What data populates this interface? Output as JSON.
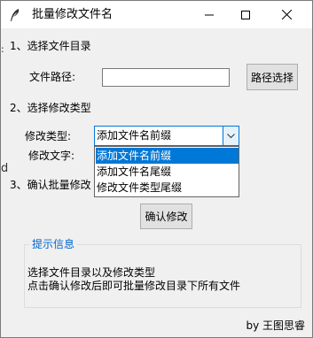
{
  "window": {
    "title": "批量修改文件名",
    "feather_icon": "feather-icon",
    "minimize_icon": "minimize-icon",
    "maximize_icon": "maximize-icon",
    "close_icon": "close-icon"
  },
  "edge_artifacts": {
    "left_colon": ":",
    "left_d": "d"
  },
  "section1": {
    "heading": "1、选择文件目录",
    "path_label": "文件路径:",
    "path_value": "",
    "browse_button": "路径选择"
  },
  "section2": {
    "heading": "2、选择修改类型",
    "type_label": "修改类型:",
    "type_selected": "添加文件名前缀",
    "text_label": "修改文字:",
    "options": [
      "添加文件名前缀",
      "添加文件名尾缀",
      "修改文件类型尾缀"
    ],
    "selected_index": 0
  },
  "section3": {
    "heading": "3、确认批量修改",
    "confirm_button": "确认修改"
  },
  "info": {
    "title": "提示信息",
    "line1": "选择文件目录以及修改类型",
    "line2": "点击确认修改后即可批量修改目录下所有文件"
  },
  "footer": {
    "author": "by 王图思睿"
  },
  "colors": {
    "accent": "#0078d7",
    "group_title": "#0066cc",
    "window_bg": "#f0f0f0"
  }
}
